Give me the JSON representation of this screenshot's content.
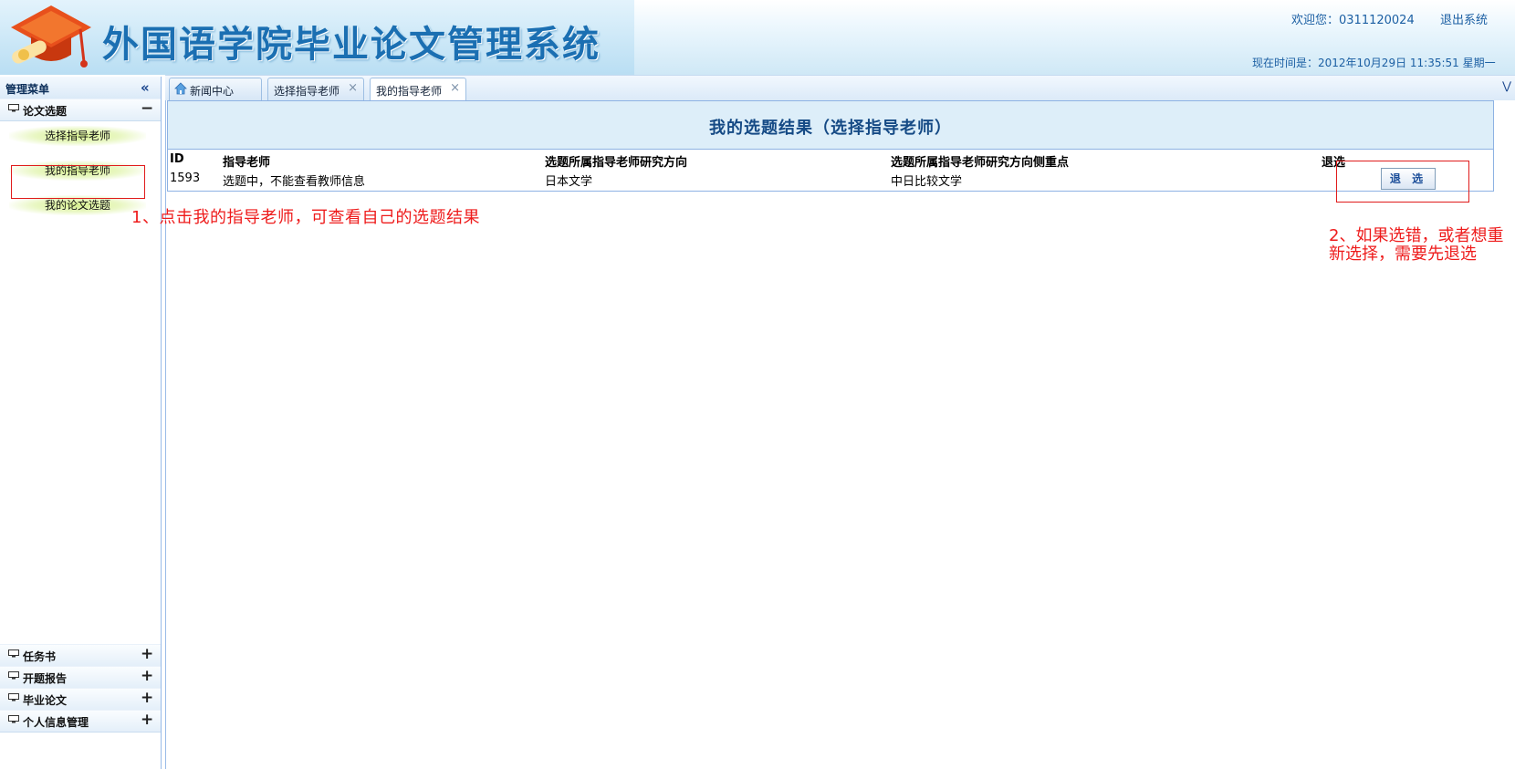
{
  "header": {
    "system_title": "外国语学院毕业论文管理系统",
    "welcome": "欢迎您：0311120024",
    "logout": "退出系统",
    "current_time": "现在时间是：2012年10月29日 11:35:51 星期一"
  },
  "sidebar": {
    "title": "管理菜单",
    "sections": [
      {
        "label": "论文选题",
        "toggle": "−",
        "items": [
          "选择指导老师",
          "我的指导老师",
          "我的论文选题"
        ]
      },
      {
        "label": "任务书",
        "toggle": "+"
      },
      {
        "label": "开题报告",
        "toggle": "+"
      },
      {
        "label": "毕业论文",
        "toggle": "+"
      },
      {
        "label": "个人信息管理",
        "toggle": "+"
      }
    ]
  },
  "tabs": [
    {
      "label": "新闻中心",
      "icon": "home-icon"
    },
    {
      "label": "选择指导老师",
      "close": "×"
    },
    {
      "label": "我的指导老师",
      "close": "×",
      "active": true
    }
  ],
  "result": {
    "title": "我的选题结果（选择指导老师）",
    "columns": [
      "ID",
      "指导老师",
      "选题所属指导老师研究方向",
      "选题所属指导老师研究方向侧重点",
      "退选"
    ],
    "rows": [
      {
        "id": "1593",
        "teacher": "选题中，不能查看教师信息",
        "direction": "日本文学",
        "focus": "中日比较文学",
        "action": "退 选"
      }
    ]
  },
  "annotations": {
    "note1": "1、点击我的指导老师，可查看自己的选题结果",
    "note2": "2、如果选错，或者想重新选择，需要先退选"
  },
  "colors": {
    "accent": "#1b6fb2",
    "annotation": "#ee1b1b",
    "nav_highlight": "#d7f08f"
  }
}
